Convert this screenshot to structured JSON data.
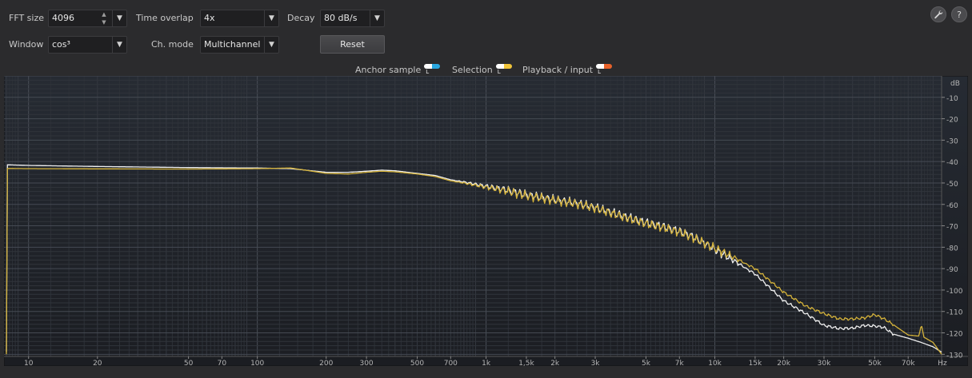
{
  "controls": {
    "fft_size": {
      "label": "FFT size",
      "value": "4096"
    },
    "time_overlap": {
      "label": "Time overlap",
      "value": "4x"
    },
    "decay": {
      "label": "Decay",
      "value": "80 dB/s"
    },
    "window": {
      "label": "Window",
      "value": "cos³"
    },
    "ch_mode": {
      "label": "Ch. mode",
      "value": "Multichannel"
    },
    "reset_label": "Reset"
  },
  "toolbar": {
    "settings_icon": "wrench-icon",
    "help_label": "?"
  },
  "legend": {
    "anchor": {
      "label": "Anchor sample",
      "colors": [
        "#ffffff",
        "#2aa7e0"
      ]
    },
    "selection": {
      "label": "Selection",
      "colors": [
        "#ffffff",
        "#f0c43a"
      ]
    },
    "playback": {
      "label": "Playback / input",
      "colors": [
        "#ffffff",
        "#e8622a"
      ]
    },
    "lr": "L R"
  },
  "chart_data": {
    "type": "line",
    "x_scale": "log",
    "xlim": [
      8,
      98000
    ],
    "ylim": [
      0,
      -131
    ],
    "grid": true,
    "x_unit_label": "Hz",
    "y_unit_label": "dB",
    "x_ticks": [
      {
        "v": 10,
        "t": "10"
      },
      {
        "v": 20,
        "t": "20"
      },
      {
        "v": 50,
        "t": "50"
      },
      {
        "v": 70,
        "t": "70"
      },
      {
        "v": 100,
        "t": "100"
      },
      {
        "v": 200,
        "t": "200"
      },
      {
        "v": 300,
        "t": "300"
      },
      {
        "v": 500,
        "t": "500"
      },
      {
        "v": 700,
        "t": "700"
      },
      {
        "v": 1000,
        "t": "1k"
      },
      {
        "v": 1500,
        "t": "1,5k"
      },
      {
        "v": 2000,
        "t": "2k"
      },
      {
        "v": 3000,
        "t": "3k"
      },
      {
        "v": 5000,
        "t": "5k"
      },
      {
        "v": 7000,
        "t": "7k"
      },
      {
        "v": 10000,
        "t": "10k"
      },
      {
        "v": 15000,
        "t": "15k"
      },
      {
        "v": 20000,
        "t": "20k"
      },
      {
        "v": 30000,
        "t": "30k"
      },
      {
        "v": 50000,
        "t": "50k"
      },
      {
        "v": 70000,
        "t": "70k"
      }
    ],
    "y_ticks": [
      {
        "v": -10,
        "t": "10"
      },
      {
        "v": -20,
        "t": "20"
      },
      {
        "v": -30,
        "t": "30"
      },
      {
        "v": -40,
        "t": "40"
      },
      {
        "v": -50,
        "t": "50"
      },
      {
        "v": -60,
        "t": "60"
      },
      {
        "v": -70,
        "t": "70"
      },
      {
        "v": -80,
        "t": "80"
      },
      {
        "v": -90,
        "t": "90"
      },
      {
        "v": -100,
        "t": "100"
      },
      {
        "v": -110,
        "t": "110"
      },
      {
        "v": -120,
        "t": "120"
      },
      {
        "v": -130,
        "t": "130"
      }
    ],
    "series": [
      {
        "color": "#f0f0f0",
        "points": [
          [
            8,
            -41.5
          ],
          [
            10,
            -41.8
          ],
          [
            20,
            -42.3
          ],
          [
            50,
            -42.8
          ],
          [
            100,
            -43.0
          ],
          [
            140,
            -43.3
          ],
          [
            200,
            -45.0
          ],
          [
            250,
            -45.0
          ],
          [
            300,
            -44.5
          ],
          [
            350,
            -44.0
          ],
          [
            400,
            -44.3
          ],
          [
            500,
            -45.5
          ],
          [
            600,
            -46.5
          ],
          [
            700,
            -48.5
          ],
          [
            800,
            -49.5
          ],
          [
            1000,
            -51.5
          ],
          [
            1200,
            -53.0
          ],
          [
            1500,
            -55.5
          ],
          [
            2000,
            -57.8
          ],
          [
            2500,
            -59.5
          ],
          [
            3000,
            -61.5
          ],
          [
            4000,
            -65.5
          ],
          [
            5000,
            -68.5
          ],
          [
            6000,
            -70.5
          ],
          [
            7000,
            -72.5
          ],
          [
            8000,
            -75.0
          ],
          [
            10000,
            -81.0
          ],
          [
            12000,
            -86.0
          ],
          [
            15000,
            -92.5
          ],
          [
            20000,
            -105.0
          ],
          [
            25000,
            -111.0
          ],
          [
            30000,
            -116.5
          ],
          [
            35000,
            -118.0
          ],
          [
            40000,
            -117.8
          ],
          [
            45000,
            -116.5
          ],
          [
            50000,
            -116.8
          ],
          [
            55000,
            -117.5
          ],
          [
            60000,
            -120.5
          ],
          [
            70000,
            -122.5
          ],
          [
            80000,
            -124.5
          ],
          [
            90000,
            -126.5
          ],
          [
            98000,
            -129.0
          ]
        ]
      },
      {
        "color": "#d4b23a",
        "points": [
          [
            8,
            -43.2
          ],
          [
            10,
            -43.3
          ],
          [
            20,
            -43.4
          ],
          [
            50,
            -43.5
          ],
          [
            100,
            -43.3
          ],
          [
            140,
            -43.0
          ],
          [
            200,
            -45.5
          ],
          [
            250,
            -45.8
          ],
          [
            300,
            -45.0
          ],
          [
            350,
            -44.5
          ],
          [
            400,
            -44.8
          ],
          [
            500,
            -45.8
          ],
          [
            600,
            -47.0
          ],
          [
            700,
            -49.0
          ],
          [
            800,
            -50.0
          ],
          [
            1000,
            -52.0
          ],
          [
            1200,
            -53.5
          ],
          [
            1500,
            -56.0
          ],
          [
            2000,
            -58.2
          ],
          [
            2500,
            -59.8
          ],
          [
            3000,
            -61.8
          ],
          [
            4000,
            -66.0
          ],
          [
            5000,
            -69.0
          ],
          [
            6000,
            -71.0
          ],
          [
            7000,
            -73.0
          ],
          [
            8000,
            -75.5
          ],
          [
            10000,
            -80.5
          ],
          [
            12000,
            -84.5
          ],
          [
            15000,
            -90.0
          ],
          [
            20000,
            -101.0
          ],
          [
            25000,
            -107.5
          ],
          [
            30000,
            -111.0
          ],
          [
            35000,
            -113.5
          ],
          [
            40000,
            -113.5
          ],
          [
            45000,
            -113.0
          ],
          [
            50000,
            -111.5
          ],
          [
            55000,
            -113.5
          ],
          [
            60000,
            -116.0
          ],
          [
            70000,
            -121.0
          ],
          [
            78000,
            -121.5
          ],
          [
            80000,
            -116.0
          ],
          [
            82000,
            -122.0
          ],
          [
            90000,
            -124.5
          ],
          [
            98000,
            -130.0
          ]
        ]
      }
    ]
  }
}
